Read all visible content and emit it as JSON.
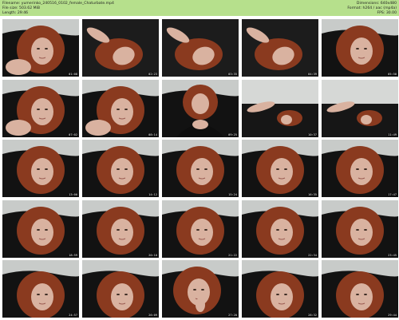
{
  "header": {
    "filename": "Filename: yumerinko_240516_0102_female_Chaturbate.mp4",
    "filesize": "File size: 503.62 MiB",
    "length": "Length: 29:46",
    "dimensions": "Dimensions: 640x480",
    "format": "Format: h264 / aac (mp4a)",
    "fps": "FPS: 30.00"
  },
  "thumbnails": [
    {
      "time": "01:08",
      "scene": "face-tilt"
    },
    {
      "time": "02:23",
      "scene": "lying-side"
    },
    {
      "time": "03:35",
      "scene": "lying-close"
    },
    {
      "time": "04:39",
      "scene": "lying-side"
    },
    {
      "time": "05:50",
      "scene": "face-close"
    },
    {
      "time": "07:02",
      "scene": "face-tilt"
    },
    {
      "time": "08:14",
      "scene": "face-tilt"
    },
    {
      "time": "09:25",
      "scene": "seated-dark"
    },
    {
      "time": "10:37",
      "scene": "couch-wide"
    },
    {
      "time": "11:49",
      "scene": "couch-wide"
    },
    {
      "time": "13:00",
      "scene": "face-hair"
    },
    {
      "time": "14:12",
      "scene": "face-hair"
    },
    {
      "time": "15:24",
      "scene": "face-hair"
    },
    {
      "time": "16:35",
      "scene": "face-hair"
    },
    {
      "time": "17:47",
      "scene": "face-hair"
    },
    {
      "time": "18:59",
      "scene": "face-hair"
    },
    {
      "time": "20:10",
      "scene": "face-hair"
    },
    {
      "time": "21:22",
      "scene": "face-hair"
    },
    {
      "time": "22:34",
      "scene": "face-hair"
    },
    {
      "time": "23:45",
      "scene": "face-hair"
    },
    {
      "time": "24:57",
      "scene": "face-low"
    },
    {
      "time": "26:09",
      "scene": "face-low"
    },
    {
      "time": "27:20",
      "scene": "face-hand"
    },
    {
      "time": "28:32",
      "scene": "face-low"
    },
    {
      "time": "29:44",
      "scene": "face-low"
    }
  ],
  "colors": {
    "header_bg": "#b6e08c",
    "wall": "#c8cbc9",
    "couch": "#121212",
    "hair": "#8a3a1f",
    "skin": "#d9b2a0"
  }
}
